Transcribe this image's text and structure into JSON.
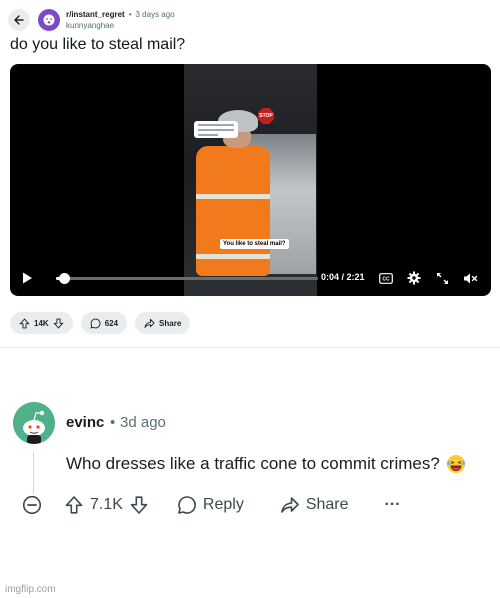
{
  "post": {
    "subreddit": "r/instant_regret",
    "dot": "•",
    "age": "3 days ago",
    "username": "kunnyanghae",
    "title": "do you like to steal mail?"
  },
  "video": {
    "overlay_caption": "You like to steal mail?",
    "stop_sign_text": "STOP",
    "time": "0:04 / 2:21",
    "cc_label": "CC",
    "progress": 0.03
  },
  "post_actions": {
    "upvotes": "14K",
    "comments": "624",
    "share": "Share"
  },
  "comment": {
    "author": "evinc",
    "dot": "•",
    "age": "3d ago",
    "body": "Who dresses like a traffic cone to commit crimes?",
    "upvotes": "7.1K",
    "reply": "Reply",
    "share": "Share",
    "more": "···"
  },
  "watermark": "imgflip.com",
  "colors": {
    "accent_orange": "#f07a1c",
    "avatar_green": "#4fb08a",
    "subreddit_purple": "#7b4bc7",
    "pill_gray": "#eaedef"
  }
}
